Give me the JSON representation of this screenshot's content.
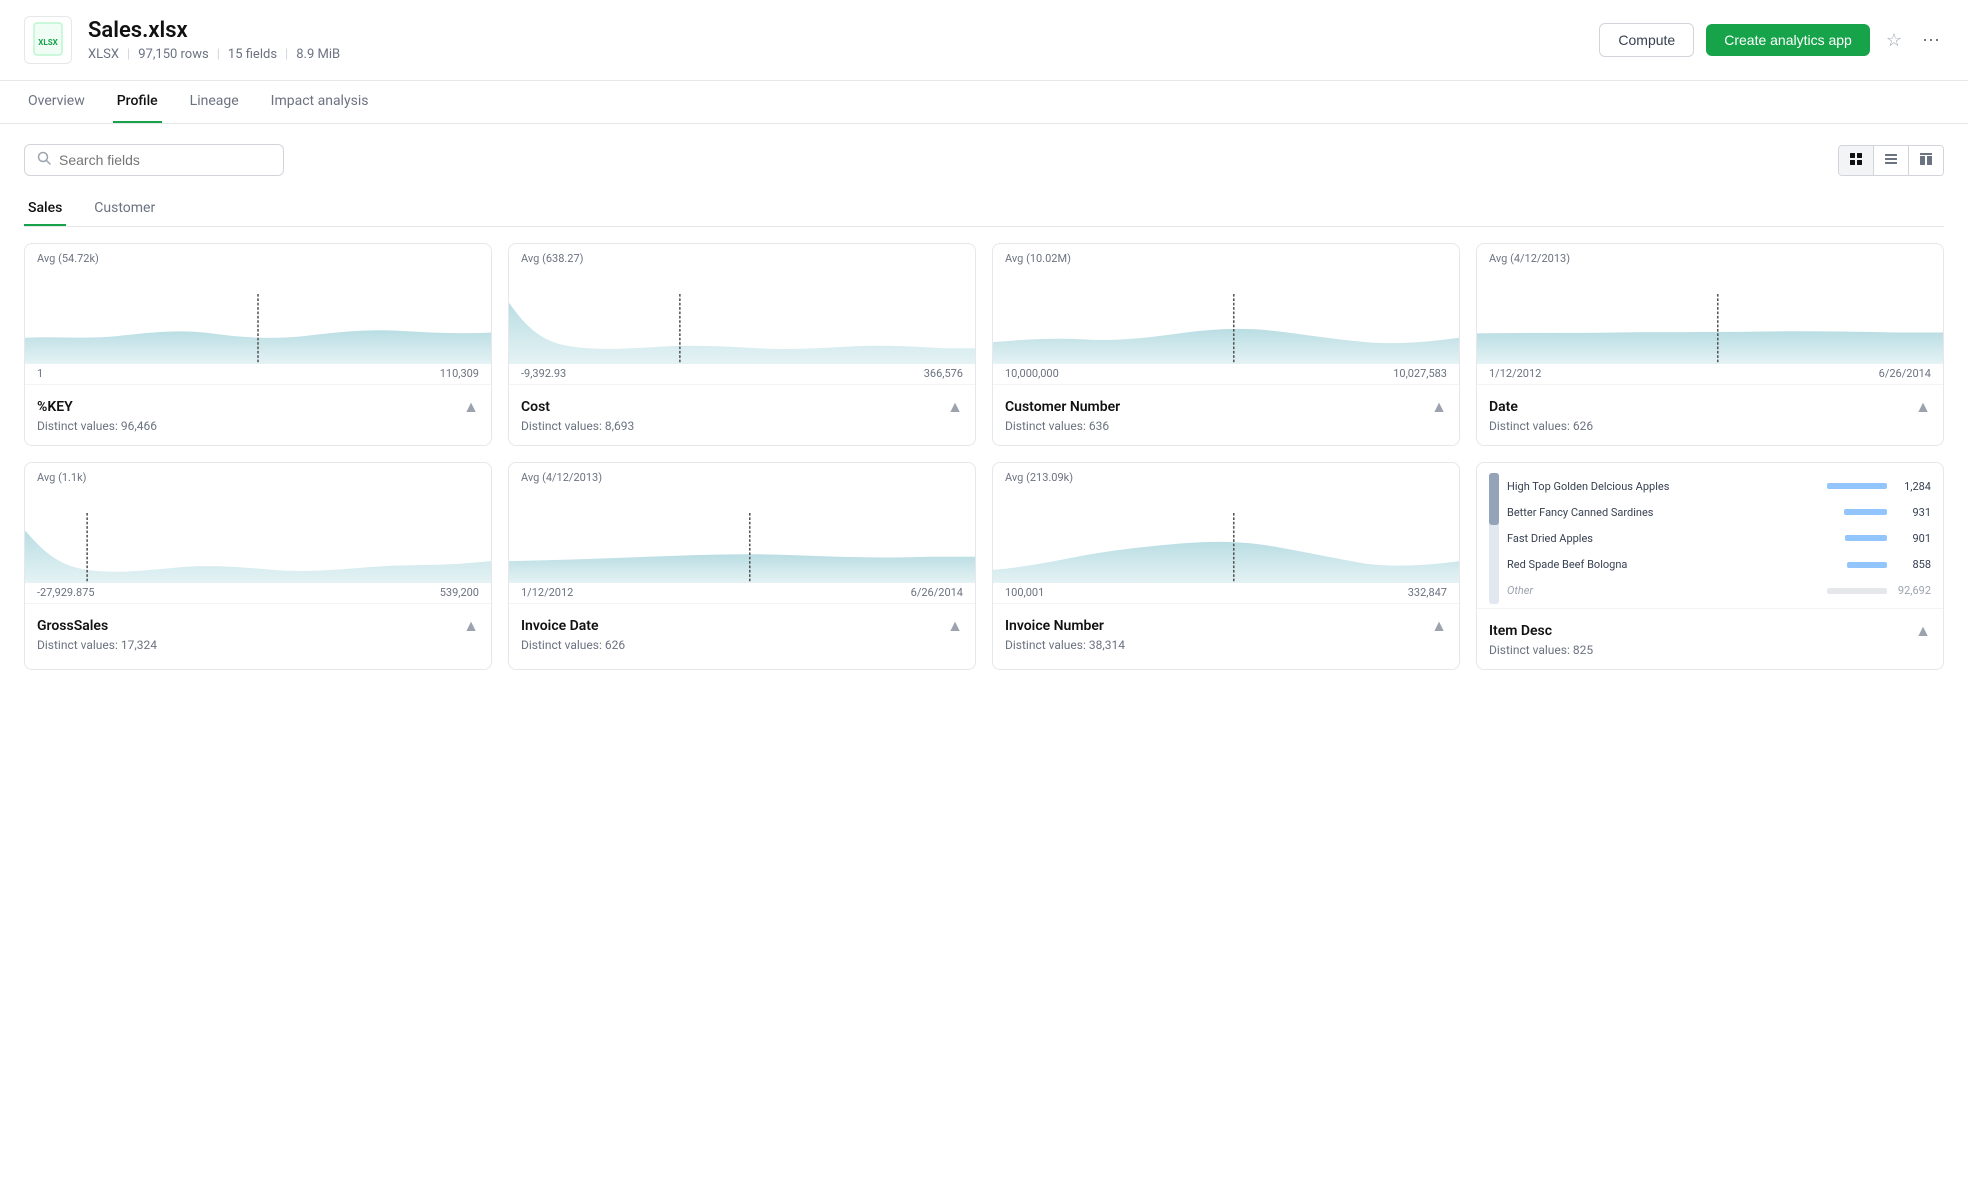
{
  "header": {
    "filename": "Sales.xlsx",
    "file_type": "XLSX",
    "rows": "97,150 rows",
    "fields": "15 fields",
    "size": "8.9 MiB",
    "compute_label": "Compute",
    "create_app_label": "Create analytics app"
  },
  "tabs": {
    "items": [
      {
        "id": "overview",
        "label": "Overview"
      },
      {
        "id": "profile",
        "label": "Profile",
        "active": true
      },
      {
        "id": "lineage",
        "label": "Lineage"
      },
      {
        "id": "impact",
        "label": "Impact analysis"
      }
    ]
  },
  "toolbar": {
    "search_placeholder": "Search fields"
  },
  "sub_tabs": [
    {
      "id": "sales",
      "label": "Sales",
      "active": true
    },
    {
      "id": "customer",
      "label": "Customer"
    }
  ],
  "cards": [
    {
      "id": "key",
      "avg_label": "Avg (54.72k)",
      "range_min": "1",
      "range_max": "110,309",
      "title": "%KEY",
      "subtitle": "Distinct values: 96,466",
      "chart_type": "area",
      "chart_color": "#a8d5dc"
    },
    {
      "id": "cost",
      "avg_label": "Avg (638.27)",
      "range_min": "-9,392.93",
      "range_max": "366,576",
      "title": "Cost",
      "subtitle": "Distinct values: 8,693",
      "chart_type": "area",
      "chart_color": "#a8d5dc"
    },
    {
      "id": "customer_number",
      "avg_label": "Avg (10.02M)",
      "range_min": "10,000,000",
      "range_max": "10,027,583",
      "title": "Customer Number",
      "subtitle": "Distinct values: 636",
      "chart_type": "area",
      "chart_color": "#a8d5dc"
    },
    {
      "id": "date",
      "avg_label": "Avg (4/12/2013)",
      "range_min": "1/12/2012",
      "range_max": "6/26/2014",
      "title": "Date",
      "subtitle": "Distinct values: 626",
      "chart_type": "area",
      "chart_color": "#a8d5dc"
    },
    {
      "id": "gross_sales",
      "avg_label": "Avg (1.1k)",
      "range_min": "-27,929.875",
      "range_max": "539,200",
      "title": "GrossSales",
      "subtitle": "Distinct values: 17,324",
      "chart_type": "area",
      "chart_color": "#a8d5dc"
    },
    {
      "id": "invoice_date",
      "avg_label": "Avg (4/12/2013)",
      "range_min": "1/12/2012",
      "range_max": "6/26/2014",
      "title": "Invoice Date",
      "subtitle": "Distinct values: 626",
      "chart_type": "area",
      "chart_color": "#a8d5dc"
    },
    {
      "id": "invoice_number",
      "avg_label": "Avg (213.09k)",
      "range_min": "100,001",
      "range_max": "332,847",
      "title": "Invoice Number",
      "subtitle": "Distinct values: 38,314",
      "chart_type": "area",
      "chart_color": "#a8d5dc"
    },
    {
      "id": "item_desc",
      "title": "Item Desc",
      "subtitle": "Distinct values: 825",
      "chart_type": "bar",
      "bar_items": [
        {
          "label": "High Top Golden Delcious Apples",
          "value": 1284,
          "pct": 95
        },
        {
          "label": "Better Fancy Canned Sardines",
          "value": 931,
          "pct": 69
        },
        {
          "label": "Fast Dried Apples",
          "value": 901,
          "pct": 66
        },
        {
          "label": "Red Spade Beef Bologna",
          "value": 858,
          "pct": 63
        },
        {
          "label": "Other",
          "value": 92692,
          "value_label": "92,692",
          "pct": 100,
          "is_other": true
        }
      ]
    }
  ]
}
